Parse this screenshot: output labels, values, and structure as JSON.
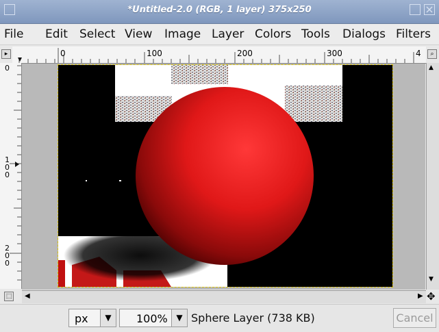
{
  "window": {
    "title": "*Untitled-2.0 (RGB, 1 layer) 375x250"
  },
  "menu": [
    "File",
    "Edit",
    "Select",
    "View",
    "Image",
    "Layer",
    "Colors",
    "Tools",
    "Dialogs",
    "Filters"
  ],
  "rulers": {
    "h_labels": [
      "0",
      "100",
      "200",
      "300",
      "4"
    ],
    "v_labels": [
      "0",
      "1\n0\n0",
      "2\n0\n0"
    ]
  },
  "status": {
    "unit": "px",
    "zoom": "100%",
    "message": "Sphere Layer (738 KB)",
    "cancel_label": "Cancel"
  },
  "icons": [
    "window-menu-icon",
    "minimize-icon",
    "close-icon",
    "quick-mask-icon",
    "navigate-icon",
    "zoom-icon",
    "ruler-menu-icon"
  ]
}
